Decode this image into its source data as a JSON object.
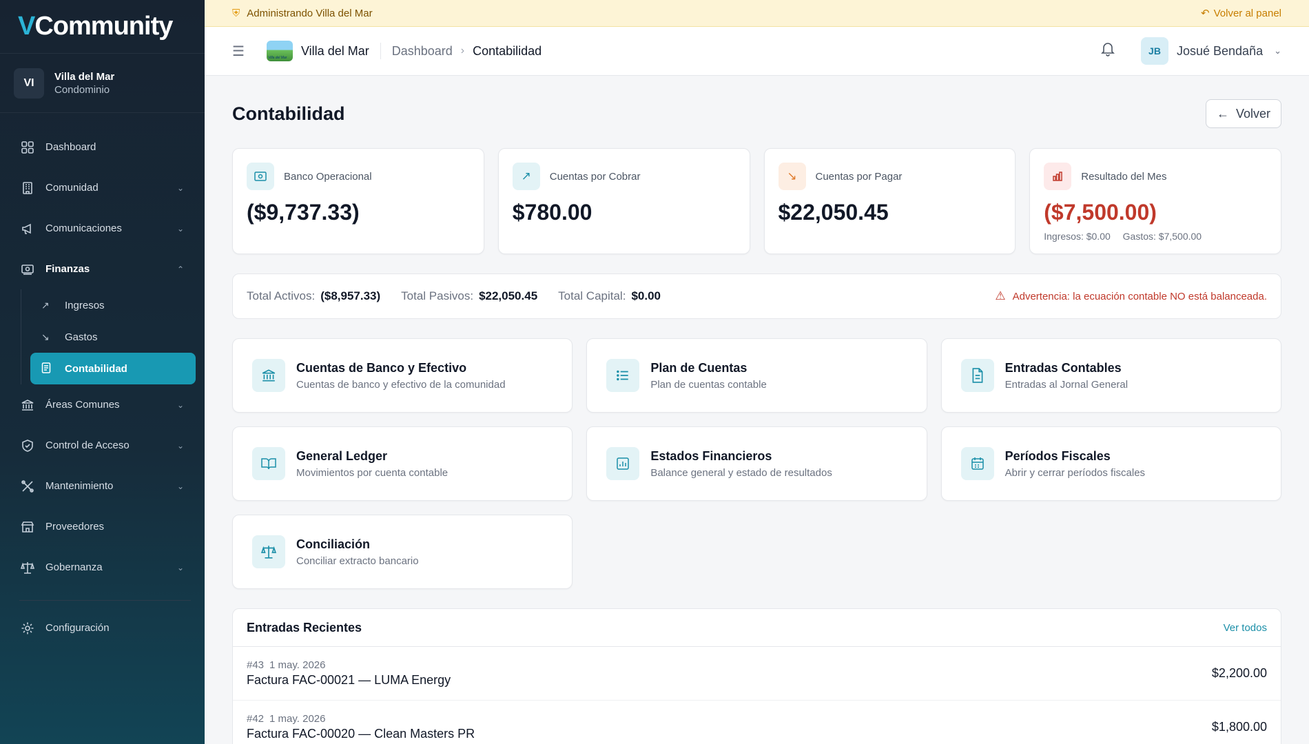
{
  "brand": {
    "logo_v": "V",
    "logo_rest": "Community"
  },
  "community": {
    "initials": "VI",
    "name": "Villa del Mar",
    "type": "Condominio"
  },
  "sidebar": {
    "items": [
      {
        "label": "Dashboard"
      },
      {
        "label": "Comunidad"
      },
      {
        "label": "Comunicaciones"
      },
      {
        "label": "Finanzas"
      },
      {
        "label": "Áreas Comunes"
      },
      {
        "label": "Control de Acceso"
      },
      {
        "label": "Mantenimiento"
      },
      {
        "label": "Proveedores"
      },
      {
        "label": "Gobernanza"
      },
      {
        "label": "Configuración"
      }
    ],
    "finanzas_sub": [
      {
        "label": "Ingresos"
      },
      {
        "label": "Gastos"
      },
      {
        "label": "Contabilidad"
      }
    ]
  },
  "banner": {
    "text": "Administrando Villa del Mar",
    "back": "Volver al panel"
  },
  "topbar": {
    "community": "Villa del Mar",
    "crumbs": [
      "Dashboard",
      "Contabilidad"
    ],
    "user_initials": "JB",
    "user_name": "Josué Bendaña"
  },
  "page": {
    "title": "Contabilidad",
    "back_label": "Volver"
  },
  "stats": [
    {
      "label": "Banco Operacional",
      "value": "($9,737.33)"
    },
    {
      "label": "Cuentas por Cobrar",
      "value": "$780.00"
    },
    {
      "label": "Cuentas por Pagar",
      "value": "$22,050.45"
    },
    {
      "label": "Resultado del Mes",
      "value": "($7,500.00)",
      "ingresos": "Ingresos: $0.00",
      "gastos": "Gastos: $7,500.00"
    }
  ],
  "balance": {
    "activos_label": "Total Activos:",
    "activos": "($8,957.33)",
    "pasivos_label": "Total Pasivos:",
    "pasivos": "$22,050.45",
    "capital_label": "Total Capital:",
    "capital": "$0.00",
    "warning": "Advertencia: la ecuación contable NO está balanceada."
  },
  "cards": [
    {
      "title": "Cuentas de Banco y Efectivo",
      "desc": "Cuentas de banco y efectivo de la comunidad"
    },
    {
      "title": "Plan de Cuentas",
      "desc": "Plan de cuentas contable"
    },
    {
      "title": "Entradas Contables",
      "desc": "Entradas al Jornal General"
    },
    {
      "title": "General Ledger",
      "desc": "Movimientos por cuenta contable"
    },
    {
      "title": "Estados Financieros",
      "desc": "Balance general y estado de resultados"
    },
    {
      "title": "Períodos Fiscales",
      "desc": "Abrir y cerrar períodos fiscales"
    },
    {
      "title": "Conciliación",
      "desc": "Conciliar extracto bancario"
    }
  ],
  "recent": {
    "title": "Entradas Recientes",
    "link": "Ver todos",
    "rows": [
      {
        "num": "#43",
        "date": "1 may. 2026",
        "desc": "Factura FAC-00021 — LUMA Energy",
        "amount": "$2,200.00"
      },
      {
        "num": "#42",
        "date": "1 may. 2026",
        "desc": "Factura FAC-00020 — Clean Masters PR",
        "amount": "$1,800.00"
      }
    ]
  },
  "colors": {
    "accent": "#1899b3",
    "negative": "#c0392b",
    "warning_banner": "#fdf4d6"
  }
}
